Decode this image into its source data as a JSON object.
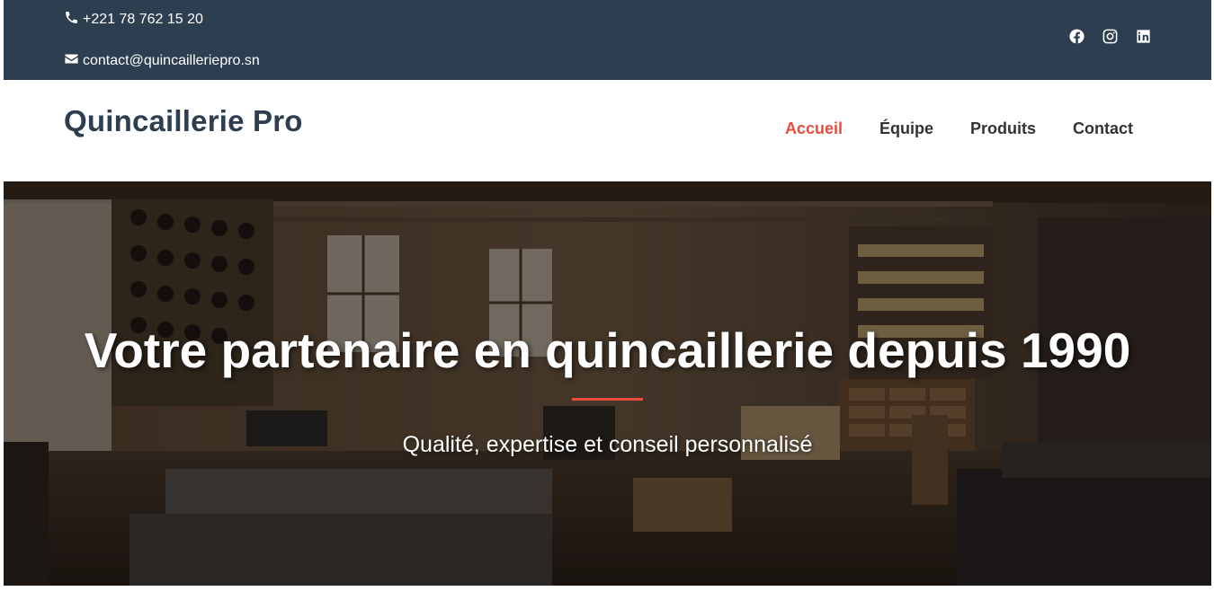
{
  "topbar": {
    "phone": "+221 78 762 15 20",
    "email": "contact@quincailleriepro.sn",
    "phone_icon": "phone-icon",
    "email_icon": "envelope-icon",
    "social": [
      "facebook-icon",
      "instagram-icon",
      "linkedin-icon"
    ]
  },
  "header": {
    "logo": "Quincaillerie Pro",
    "nav": [
      {
        "label": "Accueil",
        "active": true
      },
      {
        "label": "Équipe",
        "active": false
      },
      {
        "label": "Produits",
        "active": false
      },
      {
        "label": "Contact",
        "active": false
      }
    ]
  },
  "hero": {
    "title": "Votre partenaire en quincaillerie depuis 1990",
    "subtitle": "Qualité, expertise et conseil personnalisé"
  },
  "colors": {
    "topbar_bg": "#2c3e50",
    "brand_text": "#2c3e50",
    "accent": "#e74c3c",
    "nav_text": "#333333"
  }
}
